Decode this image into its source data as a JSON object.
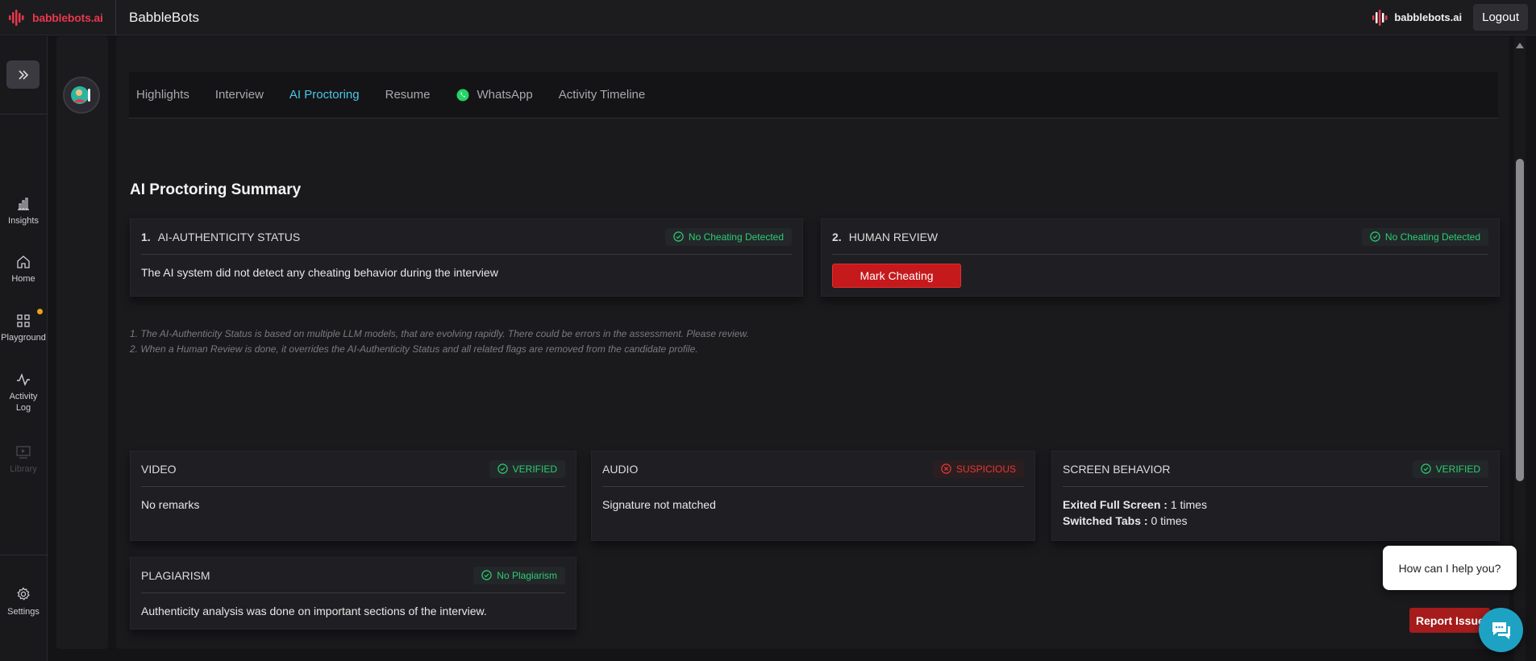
{
  "topbar": {
    "brand": "babblebots.ai",
    "app_title": "BabbleBots",
    "brand_small": "babblebots.ai",
    "logout": "Logout"
  },
  "sidebar": {
    "items": [
      {
        "label": "Insights",
        "icon": "bar-chart-icon"
      },
      {
        "label": "Home",
        "icon": "home-icon"
      },
      {
        "label": "Playground",
        "icon": "grid-icon"
      },
      {
        "label": "Activity Log",
        "icon": "activity-icon"
      },
      {
        "label": "Library",
        "icon": "library-icon"
      },
      {
        "label": "Settings",
        "icon": "gear-icon"
      }
    ]
  },
  "tabs": [
    {
      "label": "Highlights"
    },
    {
      "label": "Interview"
    },
    {
      "label": "AI Proctoring"
    },
    {
      "label": "Resume"
    },
    {
      "label": "WhatsApp"
    },
    {
      "label": "Activity Timeline"
    }
  ],
  "summary": {
    "title": "AI Proctoring Summary",
    "authenticity": {
      "num": "1.",
      "title": "AI-AUTHENTICITY STATUS",
      "status": "No Cheating Detected",
      "body": "The AI system did not detect any cheating behavior during the interview"
    },
    "human_review": {
      "num": "2.",
      "title": "HUMAN REVIEW",
      "status": "No Cheating Detected",
      "button": "Mark Cheating"
    },
    "notes": [
      "1. The AI-Authenticity Status is based on multiple LLM models, that are evolving rapidly. There could be errors in the assessment. Please review.",
      "2. When a Human Review is done, it overrides the AI-Authenticity Status and all related flags are removed from the candidate profile."
    ]
  },
  "checks": {
    "video": {
      "title": "VIDEO",
      "status": "VERIFIED",
      "body": "No remarks"
    },
    "audio": {
      "title": "AUDIO",
      "status": "SUSPICIOUS",
      "body": "Signature not matched"
    },
    "screen": {
      "title": "SCREEN BEHAVIOR",
      "status": "VERIFIED",
      "exited_label": "Exited Full Screen :",
      "exited_value": "1 times",
      "switched_label": "Switched Tabs :",
      "switched_value": "0 times"
    },
    "plagiarism": {
      "title": "PLAGIARISM",
      "status": "No Plagiarism",
      "body": "Authenticity analysis was done on important sections of the interview."
    }
  },
  "chat": {
    "prompt": "How can I help you?",
    "report": "Report Issue"
  },
  "colors": {
    "accent": "#4cc6e8",
    "verified": "#2ecc71",
    "suspicious": "#e53935",
    "danger_button": "#c5191b"
  }
}
